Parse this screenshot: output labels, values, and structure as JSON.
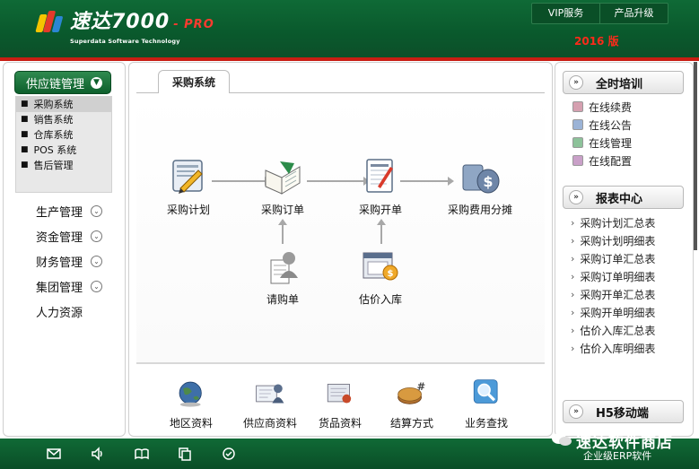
{
  "header": {
    "logo_title": "速达7000",
    "logo_pro": "- PRO",
    "logo_sub": "Superdata Software Technology",
    "links": [
      "VIP服务",
      "产品升级"
    ],
    "year_badge": "2016 版"
  },
  "left_nav": {
    "active": "供应链管理",
    "sub_items": [
      "采购系统",
      "销售系统",
      "仓库系统",
      "POS 系统",
      "售后管理"
    ],
    "items": [
      "生产管理",
      "资金管理",
      "财务管理",
      "集团管理",
      "人力资源"
    ]
  },
  "center": {
    "tab": "采购系统",
    "flow": {
      "plan": "采购计划",
      "order": "采购订单",
      "invoice": "采购开单",
      "cost_split": "采购费用分摊",
      "request": "请购单",
      "estimate": "估价入库"
    },
    "bottom": [
      "地区资料",
      "供应商资料",
      "货品资料",
      "结算方式",
      "业务查找"
    ]
  },
  "right": {
    "training_title": "全时培训",
    "training_items": [
      "在线续费",
      "在线公告",
      "在线管理",
      "在线配置"
    ],
    "report_title": "报表中心",
    "report_items": [
      "采购计划汇总表",
      "采购计划明细表",
      "采购订单汇总表",
      "采购订单明细表",
      "采购开单汇总表",
      "采购开单明细表",
      "估价入库汇总表",
      "估价入库明细表"
    ],
    "mobile_title": "H5移动端"
  },
  "footer": {
    "icons": [
      "mail-icon",
      "speaker-icon",
      "book-icon",
      "copy-icon",
      "check-circle-icon"
    ]
  },
  "watermark": {
    "main": "速达软件商店",
    "sub": "企业级ERP软件"
  },
  "colors": {
    "brand_green": "#0c5a2e",
    "accent_red": "#c81d13"
  }
}
